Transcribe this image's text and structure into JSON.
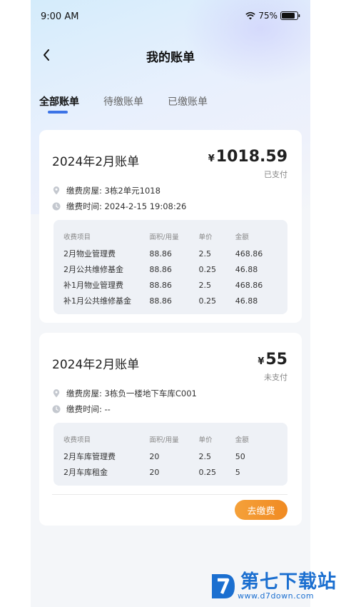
{
  "status_bar": {
    "time": "9:00 AM",
    "battery": "75%"
  },
  "nav": {
    "title": "我的账单"
  },
  "tabs": [
    {
      "label": "全部账单",
      "active": true
    },
    {
      "label": "待缴账单",
      "active": false
    },
    {
      "label": "已缴账单",
      "active": false
    }
  ],
  "bills": [
    {
      "title": "2024年2月账单",
      "currency": "¥",
      "amount": "1018.59",
      "status": "已支付",
      "house_label": "缴费房屋: 3栋2单元1018",
      "time_label": "缴费时间: 2024-2-15  19:08:26",
      "headers": [
        "收费项目",
        "面积/用量",
        "单价",
        "金额"
      ],
      "rows": [
        [
          "2月物业管理费",
          "88.86",
          "2.5",
          "468.86"
        ],
        [
          "2月公共维修基金",
          "88.86",
          "0.25",
          "46.88"
        ],
        [
          "补1月物业管理费",
          "88.86",
          "2.5",
          "468.86"
        ],
        [
          "补1月公共维修基金",
          "88.86",
          "0.25",
          "46.88"
        ]
      ]
    },
    {
      "title": "2024年2月账单",
      "currency": "¥",
      "amount": "55",
      "status": "未支付",
      "house_label": "缴费房屋: 3栋负一楼地下车库C001",
      "time_label": "缴费时间: --",
      "headers": [
        "收费项目",
        "面积/用量",
        "单价",
        "金额"
      ],
      "rows": [
        [
          "2月车库管理费",
          "20",
          "2.5",
          "50"
        ],
        [
          "2月车库租金",
          "20",
          "0.25",
          "5"
        ]
      ],
      "pay_label": "去缴费"
    }
  ],
  "watermark": {
    "text": "第七下载站",
    "url": "www.d7down.com"
  },
  "colors": {
    "accent": "#3b73e6",
    "pay_button": "#f08a22",
    "background": "#f4f6f9"
  }
}
